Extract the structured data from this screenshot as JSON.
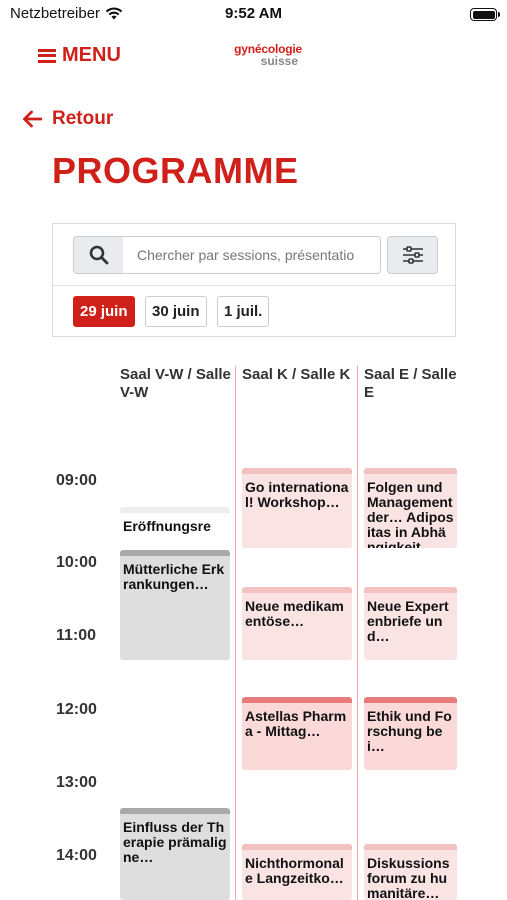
{
  "status_bar": {
    "carrier": "Netzbetreiber",
    "time": "9:52 AM"
  },
  "header": {
    "menu_label": "MENU",
    "logo_line1": "gynécologie",
    "logo_line2": "suisse"
  },
  "nav": {
    "back_label": "Retour",
    "page_title": "PROGRAMME"
  },
  "search": {
    "placeholder": "Chercher par sessions, présentatio"
  },
  "day_tabs": [
    {
      "label": "29 juin",
      "active": true
    },
    {
      "label": "30 juin",
      "active": false
    },
    {
      "label": "1 juil.",
      "active": false
    }
  ],
  "schedule": {
    "rooms": [
      "Saal V-W / Salle V-W",
      "Saal K / Salle K",
      "Saal E / Salle E"
    ],
    "times": [
      "09:00",
      "10:00",
      "11:00",
      "12:00",
      "13:00",
      "14:00"
    ],
    "events": [
      {
        "room": 0,
        "title": "Eröffnungsre",
        "style": "plain"
      },
      {
        "room": 0,
        "title": "Mütterliche Erkrankungen…",
        "style": "grey"
      },
      {
        "room": 0,
        "title": "Einfluss der Therapie prämaligne…",
        "style": "grey"
      },
      {
        "room": 1,
        "title": "Go international! Workshop…",
        "style": "pink"
      },
      {
        "room": 1,
        "title": "Neue medikamentöse…",
        "style": "pink"
      },
      {
        "room": 1,
        "title": "Astellas Pharma - Mittag…",
        "style": "pink-strong"
      },
      {
        "room": 1,
        "title": "Nichthormonale Langzeitko…",
        "style": "pink"
      },
      {
        "room": 2,
        "title": "Folgen und Management der… Adipositas in Abhängigkeit",
        "style": "pink"
      },
      {
        "room": 2,
        "title": "Neue Expertenbriefe und…",
        "style": "pink"
      },
      {
        "room": 2,
        "title": "Ethik und Forschung bei…",
        "style": "pink-strong"
      },
      {
        "room": 2,
        "title": "Diskussionsforum zu humanitäre…",
        "style": "pink"
      }
    ]
  },
  "colors": {
    "brand_red": "#d0201a",
    "session_pink": "#fae3e3",
    "session_grey": "#dedede"
  }
}
